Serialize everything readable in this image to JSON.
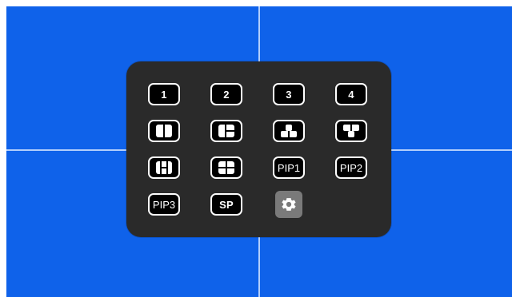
{
  "colors": {
    "background_blue": "#0f62ea",
    "panel_bg": "#2a2a2a",
    "button_bg": "#000000",
    "button_border": "#ffffff",
    "settings_bg": "#7a7a7a"
  },
  "menu": {
    "rows": [
      [
        {
          "type": "text",
          "label": "1"
        },
        {
          "type": "text",
          "label": "2"
        },
        {
          "type": "text",
          "label": "3"
        },
        {
          "type": "text",
          "label": "4"
        }
      ],
      [
        {
          "type": "icon",
          "icon": "layout-split-vertical-icon"
        },
        {
          "type": "icon",
          "icon": "layout-left-plus-two-right-icon"
        },
        {
          "type": "icon",
          "icon": "layout-one-top-two-bottom-icon"
        },
        {
          "type": "icon",
          "icon": "layout-two-top-one-bottom-icon"
        }
      ],
      [
        {
          "type": "icon",
          "icon": "layout-left-right-with-middle-icon"
        },
        {
          "type": "icon",
          "icon": "layout-quad-icon"
        },
        {
          "type": "text",
          "label": "PIP1"
        },
        {
          "type": "text",
          "label": "PIP2"
        }
      ],
      [
        {
          "type": "text",
          "label": "PIP3"
        },
        {
          "type": "text",
          "label": "SP"
        },
        {
          "type": "icon",
          "icon": "gear-icon"
        }
      ]
    ]
  }
}
